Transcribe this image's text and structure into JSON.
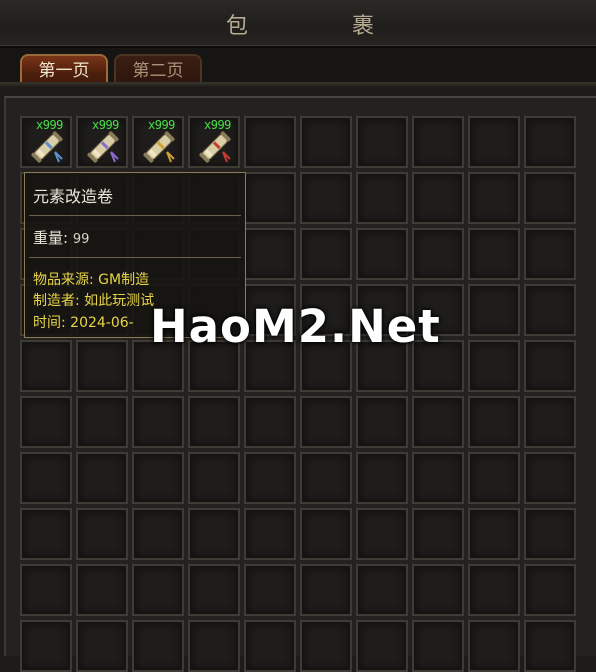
{
  "window": {
    "title_chars": [
      "包",
      "裹"
    ]
  },
  "tabs": [
    {
      "label": "第一页",
      "active": true
    },
    {
      "label": "第二页",
      "active": false
    }
  ],
  "items": [
    {
      "quantity": "x999",
      "icon": "scroll-icon",
      "color": "#5b8fd0"
    },
    {
      "quantity": "x999",
      "icon": "scroll-icon",
      "color": "#8a6bd0"
    },
    {
      "quantity": "x999",
      "icon": "scroll-icon",
      "color": "#d0a030"
    },
    {
      "quantity": "x999",
      "icon": "scroll-icon",
      "color": "#c83c30"
    }
  ],
  "tooltip": {
    "name": "元素改造卷",
    "weight_label": "重量:",
    "weight_value": "99",
    "source": "物品来源: GM制造",
    "maker": "制造者: 如此玩测试",
    "time": "时间: 2024-06-"
  },
  "watermark": "HaoM2.Net"
}
